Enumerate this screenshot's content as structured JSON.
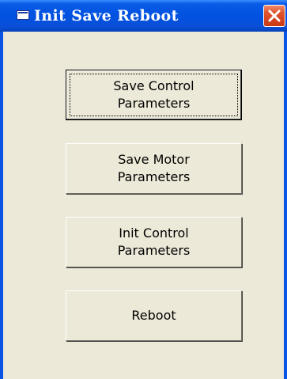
{
  "window": {
    "title": "Init Save Reboot",
    "icon": "window-app-icon",
    "close_icon": "close-x-icon",
    "accent_color": "#0054e3",
    "close_color": "#d8461f",
    "face_color": "#ece9d8"
  },
  "buttons": {
    "save_control": "Save Control Parameters",
    "save_motor": "Save Motor Parameters",
    "init_control": "Init Control Parameters",
    "reboot": "Reboot"
  }
}
